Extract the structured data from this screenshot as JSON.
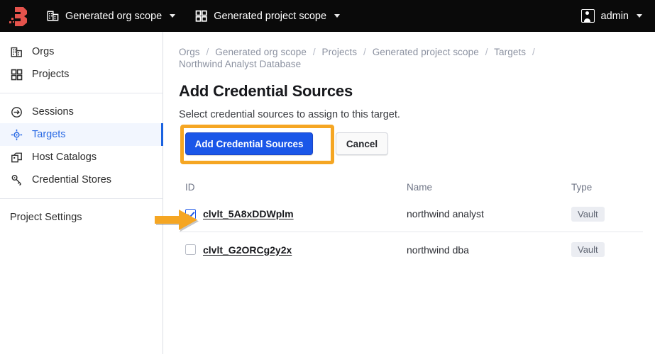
{
  "topbar": {
    "logo_name": "boundary-logo",
    "org_scope": {
      "label": "Generated org scope",
      "icon": "building-icon"
    },
    "project_scope": {
      "label": "Generated project scope",
      "icon": "grid-icon"
    },
    "user": {
      "label": "admin",
      "icon": "user-avatar-icon"
    }
  },
  "sidebar": {
    "items": [
      {
        "label": "Orgs",
        "icon": "building-icon",
        "active": false
      },
      {
        "label": "Projects",
        "icon": "grid-icon",
        "active": false
      },
      {
        "label": "Sessions",
        "icon": "session-arrow-icon",
        "active": false
      },
      {
        "label": "Targets",
        "icon": "target-crosshair-icon",
        "active": true
      },
      {
        "label": "Host Catalogs",
        "icon": "host-catalogs-icon",
        "active": false
      },
      {
        "label": "Credential Stores",
        "icon": "credential-stores-icon",
        "active": false
      }
    ],
    "footer_item": {
      "label": "Project Settings"
    }
  },
  "breadcrumb": [
    "Orgs",
    "Generated org scope",
    "Projects",
    "Generated project scope",
    "Targets",
    "Northwind Analyst Database"
  ],
  "breadcrumb_separator": "/",
  "page": {
    "title": "Add Credential Sources",
    "subtitle": "Select credential sources to assign to this target."
  },
  "actions": {
    "primary_label": "Add Credential Sources",
    "secondary_label": "Cancel"
  },
  "table": {
    "headers": {
      "id": "ID",
      "name": "Name",
      "type": "Type"
    },
    "rows": [
      {
        "checked": true,
        "id": "clvlt_5A8xDDWplm",
        "name": "northwind analyst",
        "type": "Vault"
      },
      {
        "checked": false,
        "id": "clvlt_G2ORCg2y2x",
        "name": "northwind dba",
        "type": "Vault"
      }
    ]
  },
  "annotations": {
    "highlight_color": "#f5a623",
    "arrow_color": "#f5a623",
    "arrow_name": "orange-pointer-arrow",
    "box_name": "orange-highlight-box"
  },
  "colors": {
    "accent_blue": "#1a56e8",
    "topbar_bg": "#0a0a0a",
    "logo_red": "#e4534c"
  }
}
